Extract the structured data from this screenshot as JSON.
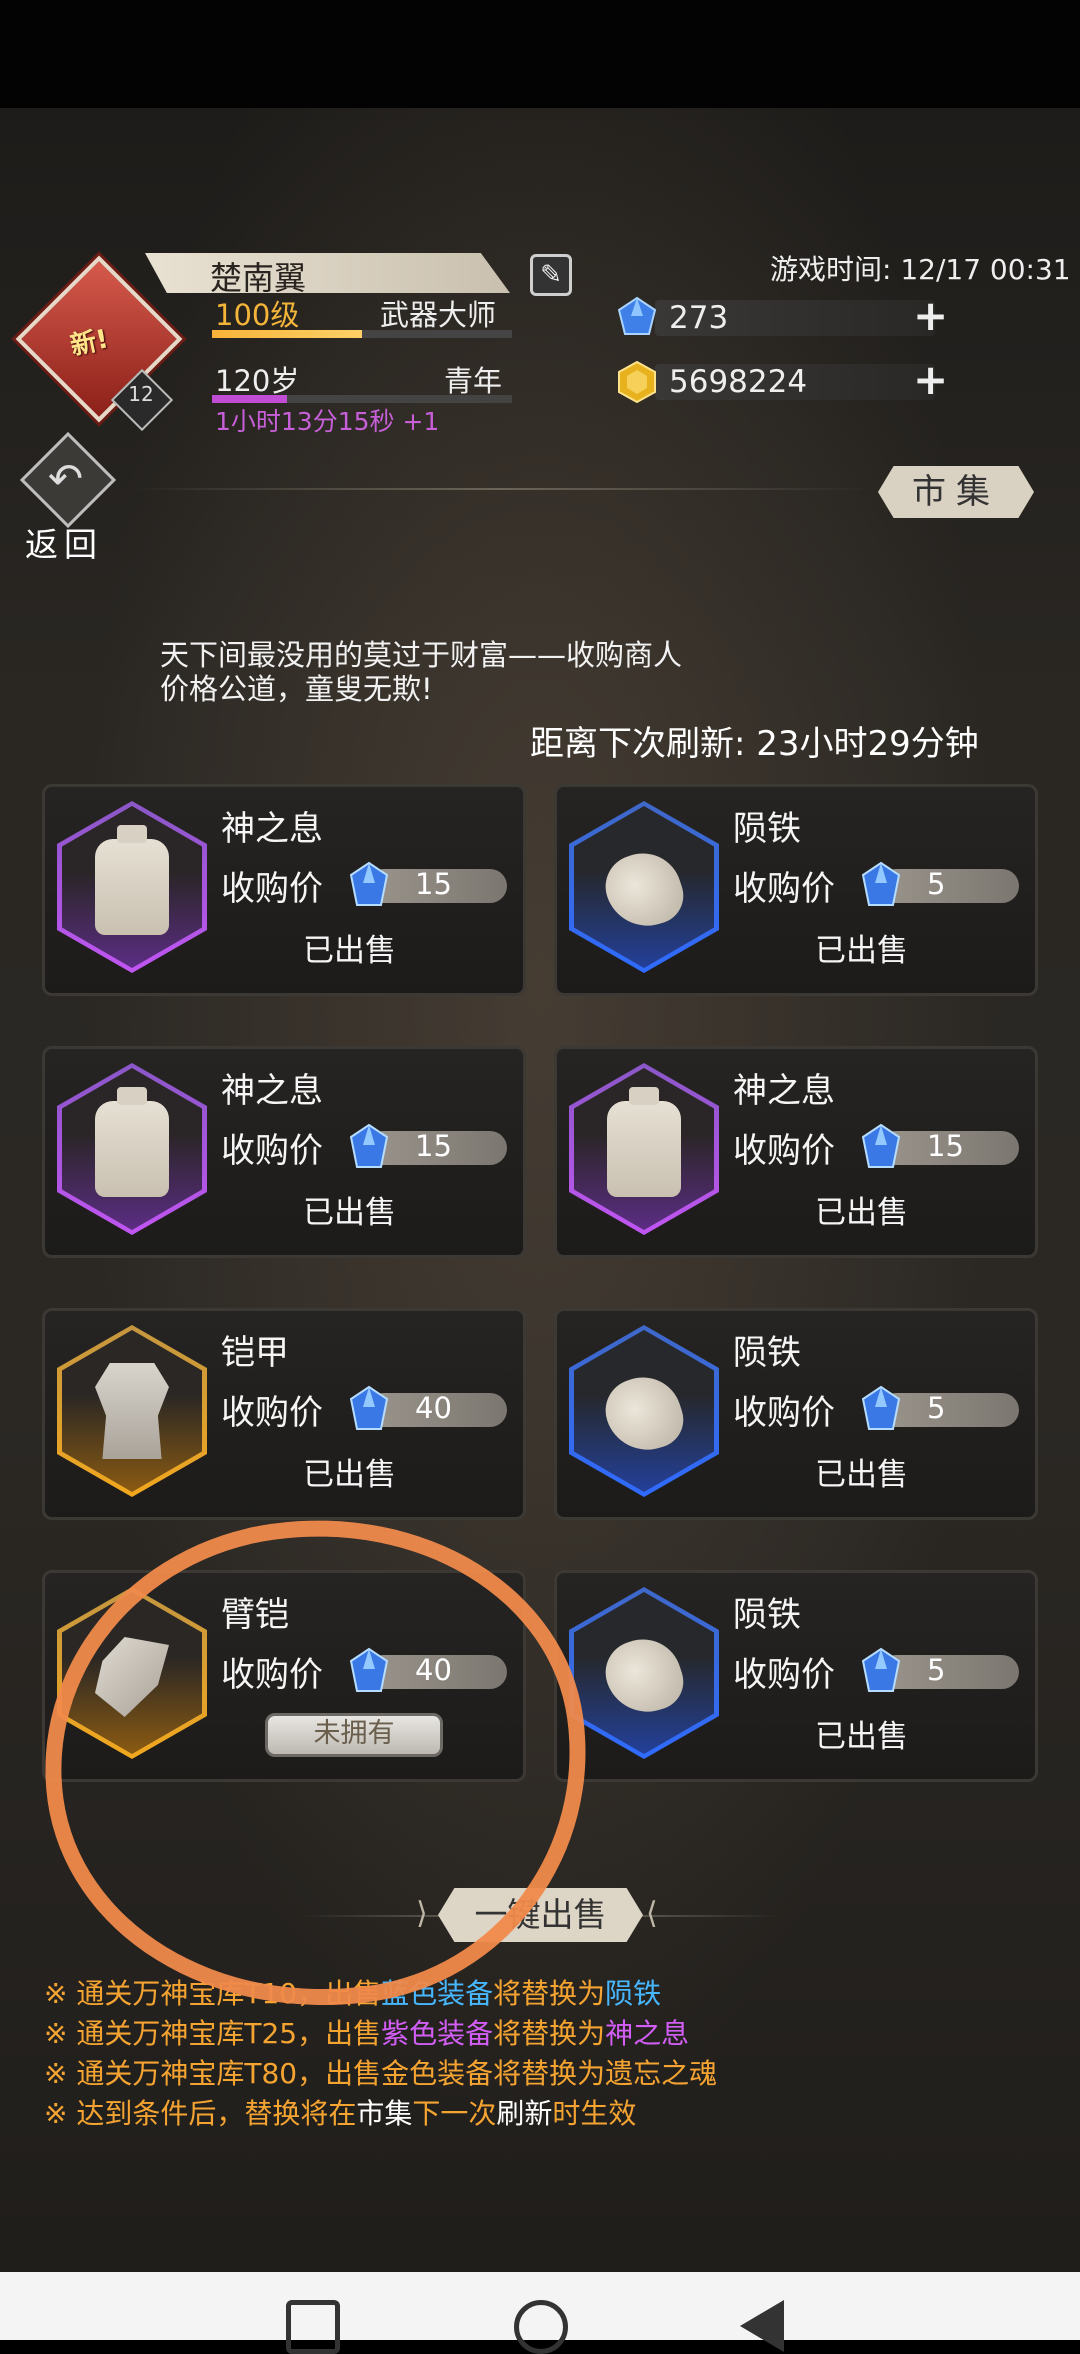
{
  "player": {
    "name": "楚南翼",
    "avatar_badge": "新!",
    "avatar_level": "12",
    "level": "100级",
    "title": "武器大师",
    "exp_fraction": 0.5,
    "age": "120岁",
    "stage": "青年",
    "age_fraction": 0.25,
    "timer": "1小时13分15秒 +1"
  },
  "game_time": "游戏时间: 12/17 00:31",
  "currencies": [
    {
      "icon": "blue-gem-icon",
      "value": "273"
    },
    {
      "icon": "gold-coin-icon",
      "value": "5698224"
    }
  ],
  "nav": {
    "back_label": "返回",
    "market_label": "市集"
  },
  "merchant": {
    "line1": "天下间最没用的莫过于财富——收购商人",
    "line2": "价格公道，童叟无欺!",
    "refresh": "距离下次刷新: 23小时29分钟"
  },
  "price_label": "收购价",
  "sold_label": "已出售",
  "not_owned_label": "未拥有",
  "items": [
    {
      "name": "神之息",
      "price": "15",
      "rarity": "purple",
      "icon": "bottle-icon",
      "status": "sold"
    },
    {
      "name": "陨铁",
      "price": "5",
      "rarity": "blue",
      "icon": "rock-icon",
      "status": "sold"
    },
    {
      "name": "神之息",
      "price": "15",
      "rarity": "purple",
      "icon": "bottle-icon",
      "status": "sold"
    },
    {
      "name": "神之息",
      "price": "15",
      "rarity": "purple",
      "icon": "bottle-icon",
      "status": "sold"
    },
    {
      "name": "铠甲",
      "price": "40",
      "rarity": "gold",
      "icon": "armor-icon",
      "status": "sold"
    },
    {
      "name": "陨铁",
      "price": "5",
      "rarity": "blue",
      "icon": "rock-icon",
      "status": "sold"
    },
    {
      "name": "臂铠",
      "price": "40",
      "rarity": "gold",
      "icon": "bracer-icon",
      "status": "not_owned"
    },
    {
      "name": "陨铁",
      "price": "5",
      "rarity": "blue",
      "icon": "rock-icon",
      "status": "sold"
    }
  ],
  "sell_all_label": "一键出售",
  "notes": {
    "n1": {
      "prefix": "※ 通关万神宝库T10，出售",
      "colored": "蓝色装备",
      "middle": "将替换为",
      "result": "陨铁"
    },
    "n2": {
      "prefix": "※ 通关万神宝库T25，出售",
      "colored": "紫色装备",
      "middle": "将替换为",
      "result": "神之息"
    },
    "n3": "※ 通关万神宝库T80，出售金色装备将替换为遗忘之魂",
    "n4": {
      "prefix": "※ 达到条件后，替换将在",
      "w1": "市集",
      "mid": "下一次",
      "w2": "刷新",
      "end": "时生效"
    }
  },
  "colors": {
    "gold": "#f5a432",
    "blue": "#47b7ff",
    "purple": "#d25ef5",
    "annotation": "#f08a4b"
  }
}
